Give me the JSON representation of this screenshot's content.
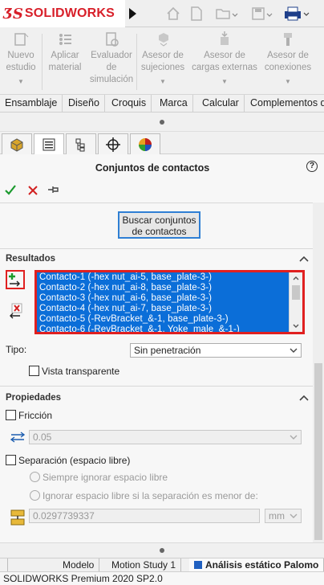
{
  "app": {
    "logo_text": "SOLIDWORKS",
    "logo_mark": "3DS"
  },
  "quick_access": [
    "home-icon",
    "new-document-icon",
    "open-folder-icon",
    "save-icon",
    "print-icon"
  ],
  "command_manager": {
    "items": [
      {
        "label_line1": "Nuevo",
        "label_line2": "estudio",
        "label_line3": ""
      },
      {
        "label_line1": "Aplicar",
        "label_line2": "material",
        "label_line3": ""
      },
      {
        "label_line1": "Evaluador",
        "label_line2": "de",
        "label_line3": "simulación"
      },
      {
        "label_line1": "Asesor de",
        "label_line2": "sujeciones",
        "label_line3": ""
      },
      {
        "label_line1": "Asesor de",
        "label_line2": "cargas externas",
        "label_line3": ""
      },
      {
        "label_line1": "Asesor de",
        "label_line2": "conexiones",
        "label_line3": ""
      }
    ]
  },
  "tabs": [
    "Ensamblaje",
    "Diseño",
    "Croquis",
    "Marca",
    "Calcular",
    "Complementos de"
  ],
  "panel_tabs": [
    "feature-manager-icon",
    "property-manager-icon",
    "configuration-manager-icon",
    "dimxpert-icon",
    "display-manager-icon"
  ],
  "property_manager": {
    "title": "Conjuntos de contactos",
    "help": "?",
    "search_button": {
      "line1": "Buscar conjuntos",
      "line2": "de contactos"
    },
    "results": {
      "heading": "Resultados",
      "items": [
        "Contacto-1 (-hex nut_ai-5, base_plate-3-)",
        "Contacto-2 (-hex nut_ai-8, base_plate-3-)",
        "Contacto-3 (-hex nut_ai-6, base_plate-3-)",
        "Contacto-4 (-hex nut_ai-7, base_plate-3-)",
        "Contacto-5 (-RevBracket_&-1, base_plate-3-)",
        "Contacto-6 (-RevBracket_&-1, Yoke_male_&-1-)"
      ],
      "type_label": "Tipo:",
      "type_value": "Sin penetración",
      "transparent_label": "Vista transparente"
    },
    "properties": {
      "heading": "Propiedades",
      "friction_label": "Fricción",
      "friction_value": "0.05",
      "gap_label": "Separación (espacio libre)",
      "radio1": "Siempre ignorar espacio libre",
      "radio2": "Ignorar espacio libre si la separación es menor de:",
      "gap_value": "0.0297739337",
      "gap_unit": "mm"
    }
  },
  "bottom_tabs": [
    "Modelo",
    "Motion Study 1",
    "Análisis estático Palomo"
  ],
  "status": "SOLIDWORKS Premium 2020 SP2.0",
  "colors": {
    "accent_red": "#d8202a",
    "selection_blue": "#0b6ed8",
    "highlight_red": "#e02020"
  }
}
